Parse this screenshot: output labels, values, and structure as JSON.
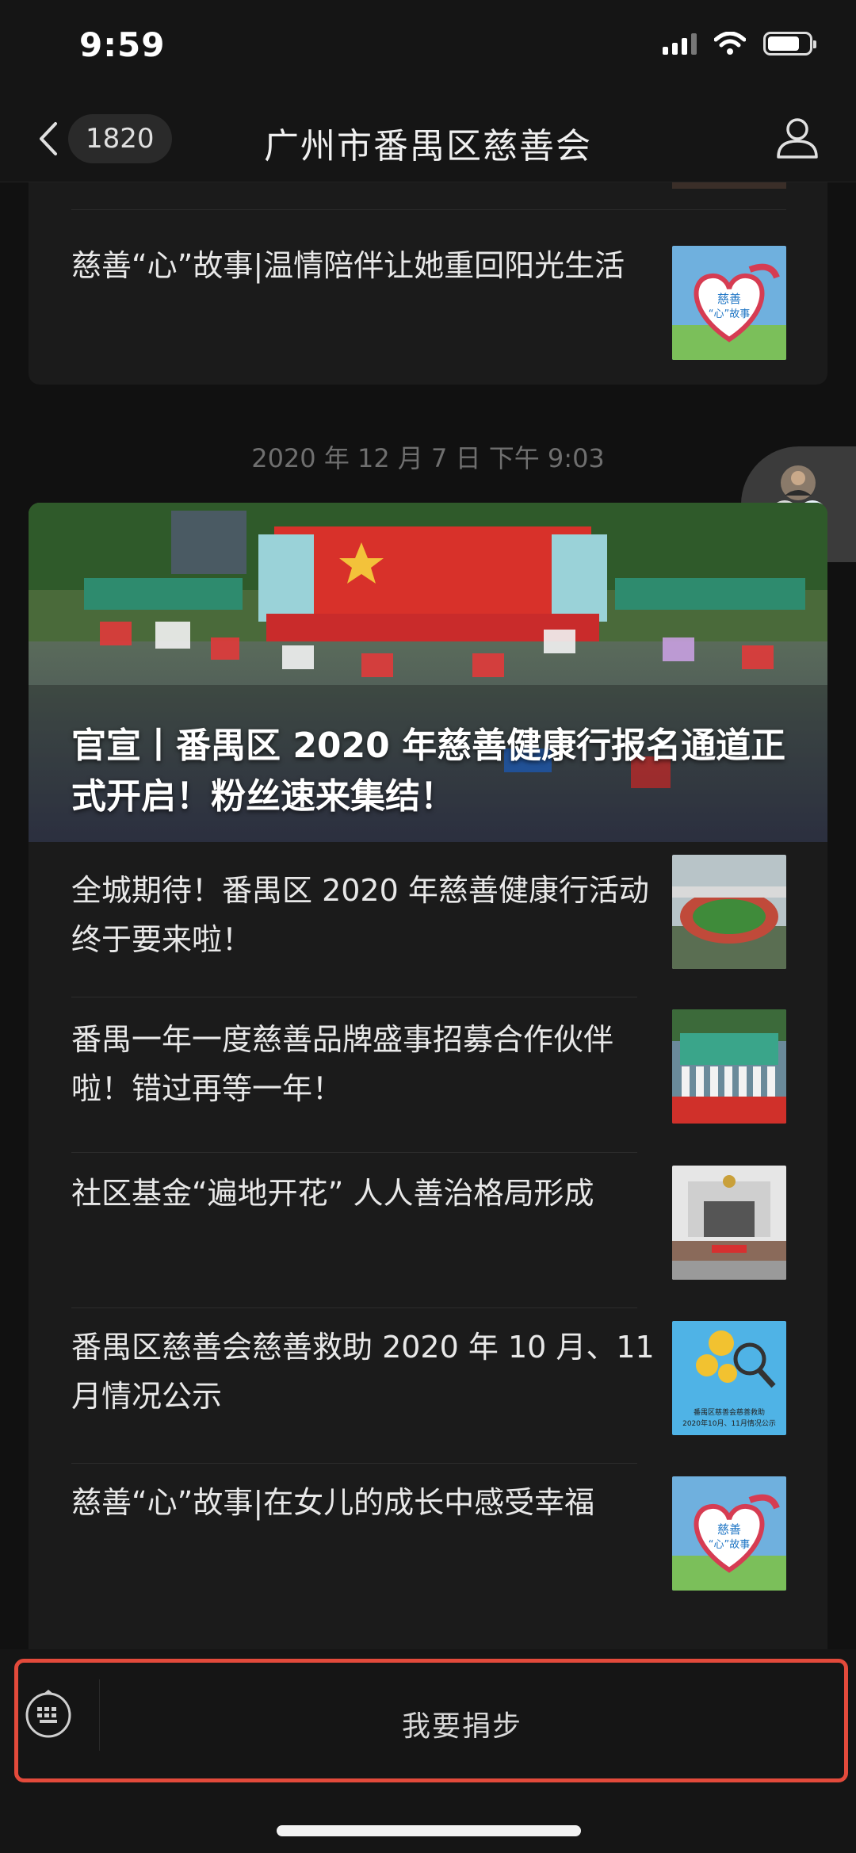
{
  "status_bar": {
    "time": "9:59"
  },
  "nav": {
    "unread_count": "1820",
    "title": "广州市番禺区慈善会"
  },
  "first_card": {
    "item_title": "慈善“心”故事|温情陪伴让她重回阳光生活",
    "thumb_text": "慈善“心”故事"
  },
  "timestamp": "2020 年 12 月 7 日  下午 9:03",
  "second_card": {
    "hero_title": "官宣丨番禺区 2020 年慈善健康行报名通道正式开启！粉丝速来集结！",
    "items": [
      {
        "title": "全城期待！番禺区 2020 年慈善健康行活动终于要来啦！",
        "thumb": "stadium"
      },
      {
        "title": "番禺一年一度慈善品牌盛事招募合作伙伴啦！错过再等一年！",
        "thumb": "group-event"
      },
      {
        "title": "社区基金“遍地开花” 人人善治格局形成",
        "thumb": "building-group"
      },
      {
        "title": "番禺区慈善会慈善救助 2020 年 10 月、11 月情况公示",
        "thumb": "coins-report",
        "thumb_caption": "番禺区慈善会慈善救助 2020年10月、11月情况公示"
      },
      {
        "title": "慈善“心”故事|在女儿的成长中感受幸福",
        "thumb": "heart-story",
        "thumb_text": "慈善“心”故事"
      }
    ]
  },
  "bottom_bar": {
    "menu_label": "我要捐步"
  },
  "colors": {
    "background": "#111111",
    "card": "#1b1b1b",
    "highlight": "#e34a3b"
  }
}
